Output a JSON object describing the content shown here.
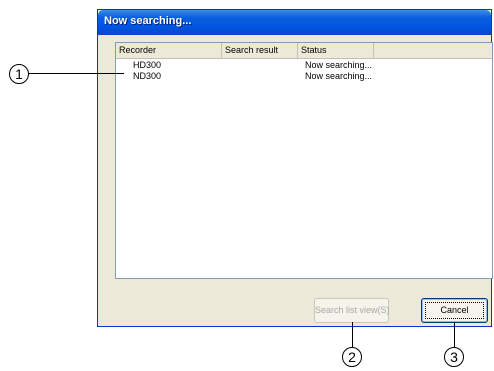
{
  "dialog": {
    "title": "Now searching...",
    "columns": [
      "Recorder",
      "Search result",
      "Status",
      ""
    ],
    "rows": [
      {
        "recorder": "HD300",
        "search_result": "",
        "status": "Now searching..."
      },
      {
        "recorder": "ND300",
        "search_result": "",
        "status": "Now searching..."
      }
    ],
    "buttons": {
      "search_list_view": "Search list view(S)",
      "cancel": "Cancel"
    }
  },
  "callouts": {
    "c1": "1",
    "c2": "2",
    "c3": "3"
  }
}
